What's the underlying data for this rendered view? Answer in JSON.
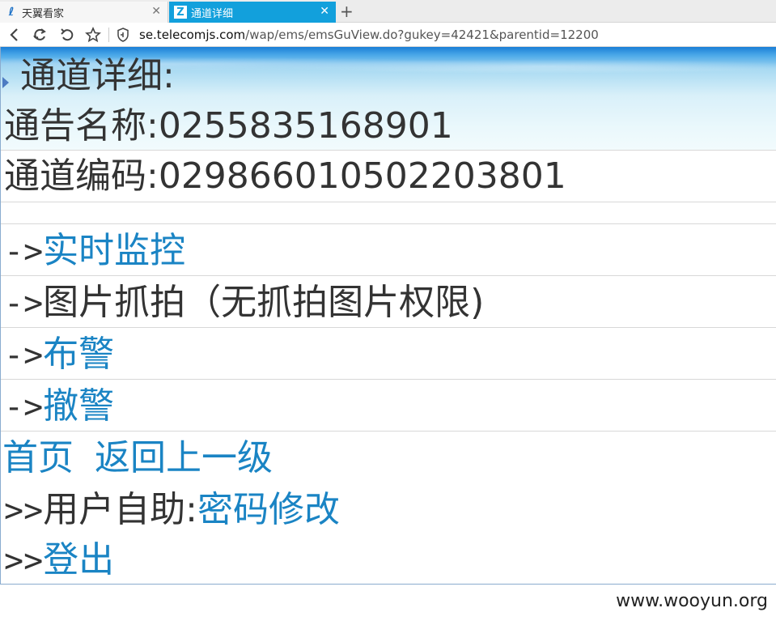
{
  "browser": {
    "tabs": [
      {
        "label": "天翼看家",
        "favicon": "tianyi-icon"
      },
      {
        "label": "通道详细",
        "favicon": "z-icon"
      }
    ],
    "address": {
      "host": "se.telecomjs.com",
      "path": "/wap/ems/emsGuView.do?gukey=42421&parentid=12200"
    }
  },
  "content": {
    "title": "通道详细:",
    "notice_name": "通告名称:0255835168901",
    "channel_code": "通道编码:029866010502203801",
    "arrow": "->",
    "menu": {
      "realtime_monitor": "实时监控",
      "snapshot_label": "图片抓拍（无抓拍图片权限)",
      "arm": "布警",
      "disarm": "撤警"
    },
    "nav": {
      "home": "首页",
      "back_up": "返回上一级"
    },
    "double_arrow": ">>",
    "self_help_label": "用户自助:",
    "password_change": "密码修改",
    "logout": "登出"
  },
  "watermark": "www.wooyun.org",
  "colors": {
    "link": "#1a84c4",
    "tab_active": "#12a0dc",
    "text": "#333333"
  }
}
